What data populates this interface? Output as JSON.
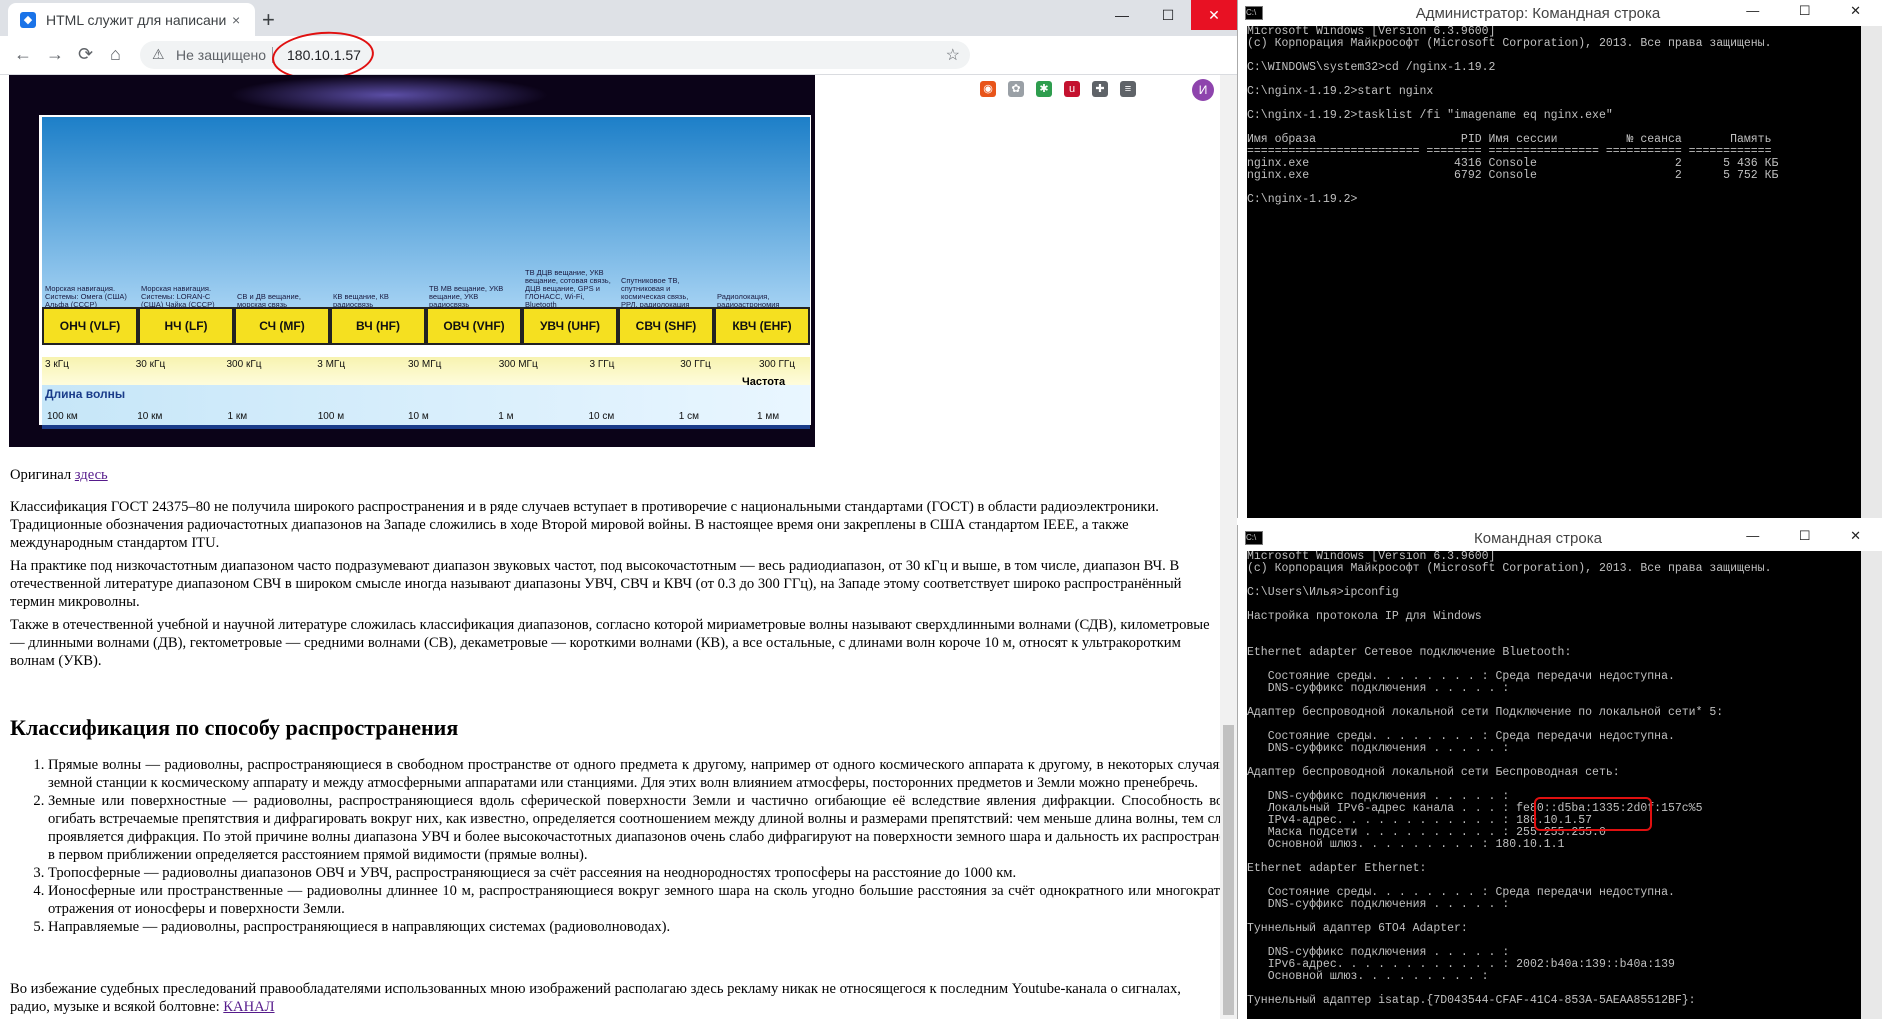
{
  "browser": {
    "tab_title": "HTML служит для написания ве",
    "tab_close": "×",
    "new_tab": "+",
    "window_buttons": [
      "—",
      "☐",
      "✕"
    ],
    "nav": {
      "back": "←",
      "forward": "→",
      "reload": "⟳",
      "home": "⌂"
    },
    "security_icon": "⚠",
    "security_text": "Не защищено",
    "url": "180.10.1.57",
    "bookmark_icon": "☆",
    "extension_icons": [
      "fox-icon",
      "paw-icon",
      "puzzle-color-icon",
      "ublock-icon",
      "puzzle-icon",
      "media-icon"
    ],
    "profile_letter": "И",
    "menu_icon": "⋮"
  },
  "spectrum": {
    "bands": [
      {
        "label": "ОНЧ (VLF)",
        "desc": "Морская навигация. Системы: Омега (США) Альфа (СССР)"
      },
      {
        "label": "НЧ (LF)",
        "desc": "Морская навигация. Системы: LORAN-C (США) Чайка (СССР)"
      },
      {
        "label": "СЧ (MF)",
        "desc": "СВ и ДВ вещание, морская связь"
      },
      {
        "label": "ВЧ (HF)",
        "desc": "КВ вещание, КВ радиосвязь"
      },
      {
        "label": "ОВЧ (VHF)",
        "desc": "ТВ МВ вещание, УКВ вещание, УКВ радиосвязь"
      },
      {
        "label": "УВЧ (UHF)",
        "desc": "ТВ ДЦВ вещание, УКВ вещание, сотовая связь, ДЦВ вещание, GPS и ГЛОНАСС, Wi-Fi, Bluetooth"
      },
      {
        "label": "СВЧ (SHF)",
        "desc": "Спутниковое ТВ, спутниковая и космическая связь, РРЛ, радиолокация"
      },
      {
        "label": "КВЧ (EHF)",
        "desc": "Радиолокация, радиоастрономия"
      }
    ],
    "freq_ticks": [
      "3 кГц",
      "30 кГц",
      "300 кГц",
      "3 МГц",
      "30 МГц",
      "300 МГц",
      "3 ГГц",
      "30 ГГц",
      "300 ГГц"
    ],
    "freq_title": "Частота",
    "wave_title": "Длина волны",
    "wave_ticks": [
      "100 км",
      "10 км",
      "1 км",
      "100 м",
      "10 м",
      "1 м",
      "10 см",
      "1 см",
      "1 мм"
    ]
  },
  "article": {
    "original_prefix": "Оригинал ",
    "original_link": "здесь",
    "p1": "Классификация ГОСТ 24375–80 не получила широкого распространения и в ряде случаев вступает в противоречие с национальными стандартами (ГОСТ) в области радиоэлектроники. Традиционные обозначения радиочастотных диапазонов на Западе сложились в ходе Второй мировой войны. В настоящее время они закреплены в США стандартом IEEE, а также международным стандартом ITU.",
    "p2": "На практике под низкочастотным диапазоном часто подразумевают диапазон звуковых частот, под высокочастотным — весь радиодиапазон, от 30 кГц и выше, в том числе, диапазон ВЧ. В отечественной литературе диапазоном СВЧ в широком смысле иногда называют диапазоны УВЧ, СВЧ и КВЧ (от 0.3 до 300 ГГц), на Западе этому соответствует широко распространённый термин микроволны.",
    "p3": "Также в отечественной учебной и научной литературе сложилась классификация диапазонов, согласно которой мириаметровые волны называют сверхдлинными волнами (СДВ), километровые — длинными волнами (ДВ), гектометровые — средними волнами (СВ), декаметровые — короткими волнами (КВ), а все остальные, с длинами волн короче 10 м, относят к ультракоротким волнам (УКВ).",
    "heading": "Классификация по способу распространения",
    "list": [
      "Прямые волны — радиоволны, распространяющиеся в свободном пространстве от одного предмета к другому, например от одного космического аппарата к другому, в некоторых случаях, от земной станции к космическому аппарату и между атмосферными аппаратами или станциями. Для этих волн влиянием атмосферы, посторонних предметов и Земли можно пренебречь.",
      "Земные или поверхностные — радиоволны, распространяющиеся вдоль сферической поверхности Земли и частично огибающие её вследствие явления дифракции. Способность волны огибать встречаемые препятствия и дифрагировать вокруг них, как известно, определяется соотношением между длиной волны и размерами препятствий: чем меньше длина волны, тем слабее проявляется дифракция. По этой причине волны диапазона УВЧ и более высокочастотных диапазонов очень слабо дифрагируют на поверхности земного шара и дальность их распространения в первом приближении определяется расстоянием прямой видимости (прямые волны).",
      "Тропосферные — радиоволны диапазонов ОВЧ и УВЧ, распространяющиеся за счёт рассеяния на неоднородностях тропосферы на расстояние до 1000 км.",
      "Ионосферные или пространственные — радиоволны длиннее 10 м, распространяющиеся вокруг земного шара на сколь угодно большие расстояния за счёт однократного или многократного отражения от ионосферы и поверхности Земли.",
      "Направляемые — радиоволны, распространяющиеся в направляющих системах (радиоволноводах)."
    ],
    "footer_text": "Во избежание судебных преследований правообладателями использованных мною изображений располагаю здесь рекламу никак не относящегося к последним Youtube-канала о сигналах, радио, музыке и всякой болтовне: ",
    "footer_link": "КАНАЛ"
  },
  "cmd1": {
    "title": "Администратор: Командная строка",
    "buttons": "— ☐ ✕",
    "text": "Microsoft Windows [Version 6.3.9600]\n(c) Корпорация Майкрософт (Microsoft Corporation), 2013. Все права защищены.\n\nC:\\WINDOWS\\system32>cd /nginx-1.19.2\n\nC:\\nginx-1.19.2>start nginx\n\nC:\\nginx-1.19.2>tasklist /fi \"imagename eq nginx.exe\"\n\nИмя образа                     PID Имя сессии          № сеанса       Память\n========================= ======== ================ =========== ============\nnginx.exe                     4316 Console                    2      5 436 КБ\nnginx.exe                     6792 Console                    2      5 752 КБ\n\nC:\\nginx-1.19.2>"
  },
  "cmd2": {
    "title": "Командная строка",
    "buttons": "— ☐ ✕",
    "text": "Microsoft Windows [Version 6.3.9600]\n(c) Корпорация Майкрософт (Microsoft Corporation), 2013. Все права защищены.\n\nC:\\Users\\Илья>ipconfig\n\nНастройка протокола IP для Windows\n\n\nEthernet adapter Сетевое подключение Bluetooth:\n\n   Состояние среды. . . . . . . . : Среда передачи недоступна.\n   DNS-суффикс подключения . . . . . :\n\nАдаптер беспроводной локальной сети Подключение по локальной сети* 5:\n\n   Состояние среды. . . . . . . . : Среда передачи недоступна.\n   DNS-суффикс подключения . . . . . :\n\nАдаптер беспроводной локальной сети Беспроводная сеть:\n\n   DNS-суффикс подключения . . . . . :\n   Локальный IPv6-адрес канала . . . : fe80::d5ba:1335:2d0f:157c%5\n   IPv4-адрес. . . . . . . . . . . . : 180.10.1.57\n   Маска подсети . . . . . . . . . . : 255.255.255.0\n   Основной шлюз. . . . . . . . . : 180.10.1.1\n\nEthernet adapter Ethernet:\n\n   Состояние среды. . . . . . . . : Среда передачи недоступна.\n   DNS-суффикс подключения . . . . . :\n\nТуннельный адаптер 6TO4 Adapter:\n\n   DNS-суффикс подключения . . . . . :\n   IPv6-адрес. . . . . . . . . . . . : 2002:b40a:139::b40a:139\n   Основной шлюз. . . . . . . . . :\n\nТуннельный адаптер isatap.{7D043544-CFAF-41C4-853A-5AEAA85512BF}:"
  },
  "colors": {
    "accent_red": "#e01010",
    "console_bg": "#000000",
    "console_fg": "#c0c0c0",
    "link": "#551a8b"
  }
}
